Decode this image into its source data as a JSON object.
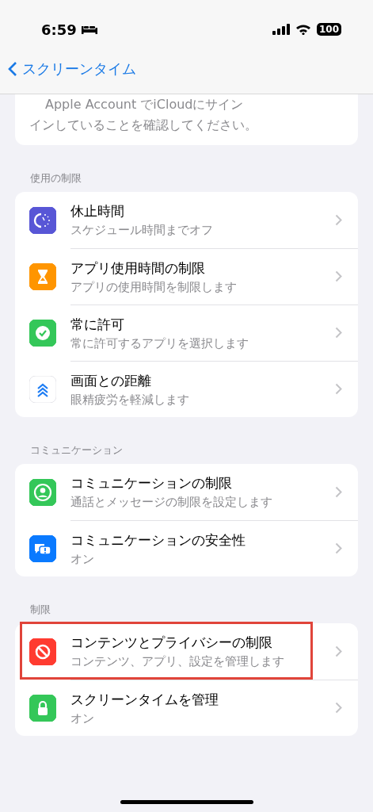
{
  "status_bar": {
    "time": "6:59",
    "battery": "100"
  },
  "nav": {
    "back_label": "スクリーンタイム"
  },
  "notice": {
    "lines": [
      "Apple Account でiCloudにサイン",
      "インしていることを確認してください。"
    ]
  },
  "sections": [
    {
      "header": "使用の制限",
      "items": [
        {
          "kind": "downtime",
          "title": "休止時間",
          "subtitle": "スケジュール時間までオフ",
          "highlighted": false
        },
        {
          "kind": "app-limits",
          "title": "アプリ使用時間の制限",
          "subtitle": "アプリの使用時間を制限します",
          "highlighted": false
        },
        {
          "kind": "always-allowed",
          "title": "常に許可",
          "subtitle": "常に許可するアプリを選択します",
          "highlighted": false
        },
        {
          "kind": "screen-distance",
          "title": "画面との距離",
          "subtitle": "眼精疲労を軽減します",
          "highlighted": false
        }
      ]
    },
    {
      "header": "コミュニケーション",
      "items": [
        {
          "kind": "communication-limits",
          "title": "コミュニケーションの制限",
          "subtitle": "通話とメッセージの制限を設定します",
          "highlighted": false
        },
        {
          "kind": "communication-safety",
          "title": "コミュニケーションの安全性",
          "subtitle": "オン",
          "highlighted": false
        }
      ]
    },
    {
      "header": "制限",
      "items": [
        {
          "kind": "content-restrictions",
          "title": "コンテンツとプライバシーの制限",
          "subtitle": "コンテンツ、アプリ、設定を管理します",
          "highlighted": true
        },
        {
          "kind": "manage",
          "title": "スクリーンタイムを管理",
          "subtitle": "オン",
          "highlighted": false
        }
      ]
    }
  ]
}
